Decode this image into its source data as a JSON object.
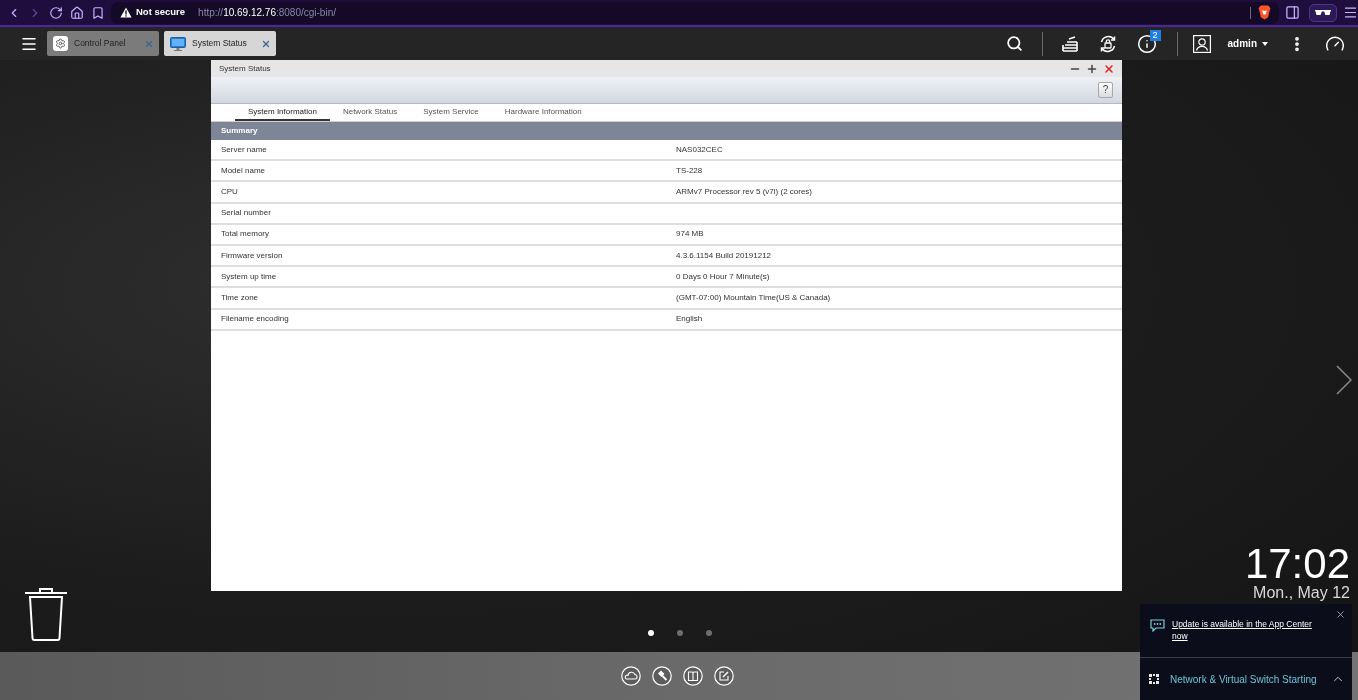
{
  "browser": {
    "security_label": "Not secure",
    "url": "http://**10.69.12.76**:8080/cgi-bin/"
  },
  "taskbar": {
    "tabs": [
      {
        "label": "Control Panel",
        "kind": "settings",
        "selected": false
      },
      {
        "label": "System Status",
        "kind": "monitor",
        "selected": true
      }
    ],
    "notification_count": "2",
    "user": "admin"
  },
  "window": {
    "title": "System Status",
    "help_button": "?",
    "tabs": [
      {
        "label": "System Information",
        "selected": true
      },
      {
        "label": "Network Status",
        "selected": false
      },
      {
        "label": "System Service",
        "selected": false
      },
      {
        "label": "Hardware Information",
        "selected": false
      }
    ],
    "section": "Summary",
    "rows": [
      {
        "label": "Server name",
        "value": "NAS032CEC"
      },
      {
        "label": "Model name",
        "value": "TS-228"
      },
      {
        "label": "CPU",
        "value": "ARMv7 Processor rev 5 (v7l) (2 cores)"
      },
      {
        "label": "Serial number"
      },
      {
        "label": "Total memory",
        "value": "974 MB"
      },
      {
        "label": "Firmware version",
        "value": "4.3.6.1154 Build 20191212"
      },
      {
        "label": "System up time",
        "value": "0 Days 0 Hour 7 Minute(s)"
      },
      {
        "label": "Time zone",
        "value": "(GMT-07:00) Mountain Time(US & Canada)"
      },
      {
        "label": "Filename encoding",
        "value": "English"
      }
    ]
  },
  "desktop": {
    "pages": [
      {
        "selected": true
      },
      {
        "selected": false
      },
      {
        "selected": false
      }
    ],
    "clock": {
      "time": "17:02",
      "date": "Mon., May 12"
    }
  },
  "notifications": [
    {
      "kind": "message",
      "text": "Update is available in the App Center now"
    },
    {
      "kind": "task",
      "text": "Network & Virtual Switch Starting"
    }
  ]
}
